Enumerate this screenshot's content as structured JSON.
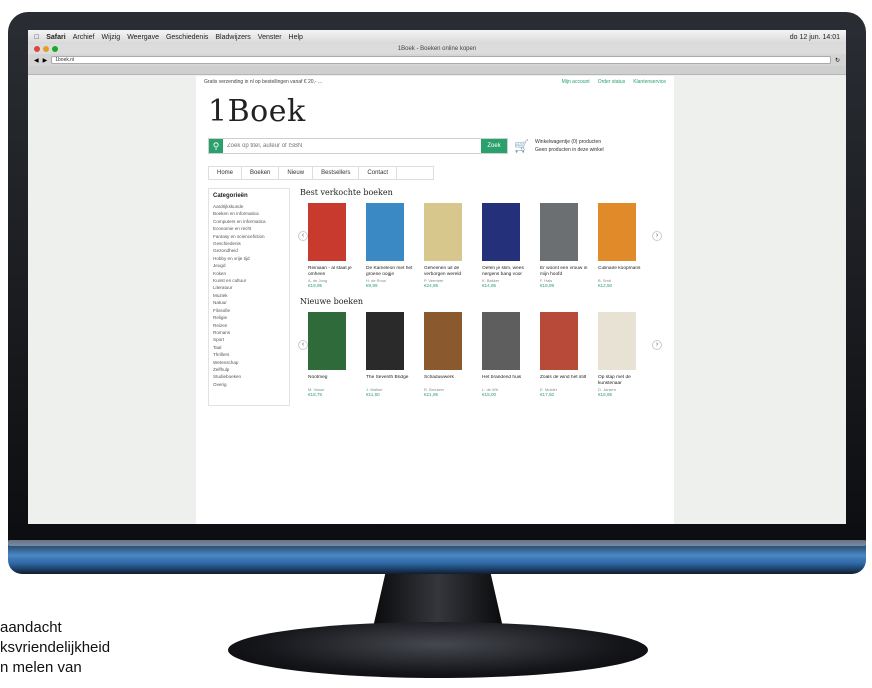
{
  "os": {
    "menubar": [
      "Safari",
      "Archief",
      "Wijzig",
      "Weergave",
      "Geschiedenis",
      "Bladwijzers",
      "Venster",
      "Help"
    ],
    "clock": "do 12 jun. 14:01",
    "window_title": "1Boek - Boeken online kopen",
    "url": "1boek.nl"
  },
  "page": {
    "topstrip": "Gratis verzending in nl op bestellingen vanaf € 20,- ...",
    "top_links": [
      "Mijn account",
      "Order status",
      "Klantenservice"
    ],
    "logo": "1Boek",
    "search_placeholder": "Zoek op titel, auteur of ISBN",
    "search_button": "Zoek",
    "cart_line1": "Winkelwagentje (0) producten",
    "cart_line2": "Geen producten in deze winkel",
    "nav": [
      "Home",
      "Boeken",
      "Nieuw",
      "Bestsellers",
      "Contact"
    ],
    "categories_title": "Categorieën",
    "categories": [
      "Aardrijkskunde",
      "Boeken en informatica",
      "Computers en informatica",
      "Economie en recht",
      "Fantasy en sciencefiction",
      "Geschiedenis",
      "Gezondheid",
      "Hobby en vrije tijd",
      "Jeugd",
      "Koken",
      "Kunst en cultuur",
      "Literatuur",
      "Muziek",
      "Natuur",
      "Filosofie",
      "Religie",
      "Reizen",
      "Romans",
      "Sport",
      "Taal",
      "Thrillers",
      "Wetenschap",
      "Zelfhulp",
      "Studieboeken",
      "Overig"
    ],
    "sections": [
      {
        "title": "Best verkochte boeken",
        "books": [
          {
            "title": "Reiniaan - al staat je omheen",
            "author": "A. de Jong",
            "price": "€19,95",
            "color": "#c93a2e"
          },
          {
            "title": "De Kameleon met het groene oogje",
            "author": "H. de Roos",
            "price": "€9,99",
            "color": "#3a88c4"
          },
          {
            "title": "Geheimen uit de verborgen wereld",
            "author": "P. Vermeer",
            "price": "€24,95",
            "color": "#d8c78c"
          },
          {
            "title": "Oefen je slim, wees nergens bang voor",
            "author": "K. Bakker",
            "price": "€14,95",
            "color": "#25307a"
          },
          {
            "title": "Er woont een vrouw in mijn hoofd",
            "author": "F. Hals",
            "price": "€19,99",
            "color": "#6b6f72"
          },
          {
            "title": "Culinaire koopmans",
            "author": "B. Smit",
            "price": "€12,50",
            "color": "#e08a2a"
          }
        ]
      },
      {
        "title": "Nieuwe boeken",
        "books": [
          {
            "title": "Nootmeg",
            "author": "M. Visser",
            "price": "€18,75",
            "color": "#2f6a3a"
          },
          {
            "title": "The Seventh Bridge",
            "author": "J. Walker",
            "price": "€11,50",
            "color": "#2a2a2a"
          },
          {
            "title": "Schaduwwerk",
            "author": "R. Brouwer",
            "price": "€21,95",
            "color": "#8a5a2e"
          },
          {
            "title": "Het brandend huis",
            "author": "L. de Wit",
            "price": "€15,00",
            "color": "#5e5e5e"
          },
          {
            "title": "Zoals de wind het stilt",
            "author": "E. Mulder",
            "price": "€17,50",
            "color": "#b84a3a"
          },
          {
            "title": "Op stap met de kunstenaar",
            "author": "D. Jansen",
            "price": "€16,95",
            "color": "#e8e2d4"
          }
        ]
      }
    ]
  },
  "caption": [
    "aandacht",
    "ksvriendelijkheid",
    "n melen van"
  ]
}
